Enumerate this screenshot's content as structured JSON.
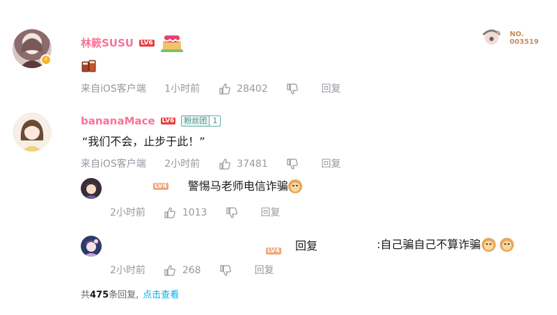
{
  "comments": [
    {
      "username": "林簌SUSU",
      "level": "LV6",
      "content_emoji": "beverage-emoji",
      "source": "来自iOS客户端",
      "time": "1小时前",
      "likes": "28402",
      "reply_label": "回复",
      "decor_card": "NO.\n003519",
      "decor_card_line1": "NO.",
      "decor_card_line2": "003519"
    },
    {
      "username": "bananaMace",
      "level": "LV6",
      "fan_badge_name": "粉丝团",
      "fan_badge_level": "1",
      "content": "“我们不会，止步于此！”",
      "source": "来自iOS客户端",
      "time": "2小时前",
      "likes": "37481",
      "reply_label": "回复"
    }
  ],
  "replies": [
    {
      "level": "LV4",
      "content": "警惕马老师电信诈骗",
      "emoji": "doge",
      "time": "2小时前",
      "likes": "1013",
      "reply_label": "回复"
    },
    {
      "level": "LV4",
      "reply_prefix": "回复",
      "content": ":自己骗自己不算诈骗",
      "emoji": "doge",
      "time": "2小时前",
      "likes": "268",
      "reply_label": "回复"
    }
  ],
  "footer": {
    "prefix": "共",
    "count": "475",
    "suffix": "条回复,",
    "link": "点击查看"
  },
  "colors": {
    "username": "#fb7299",
    "meta": "#9499a0",
    "link": "#00aeec",
    "level6": "#e93c3c",
    "level4": "#f3a57a"
  }
}
